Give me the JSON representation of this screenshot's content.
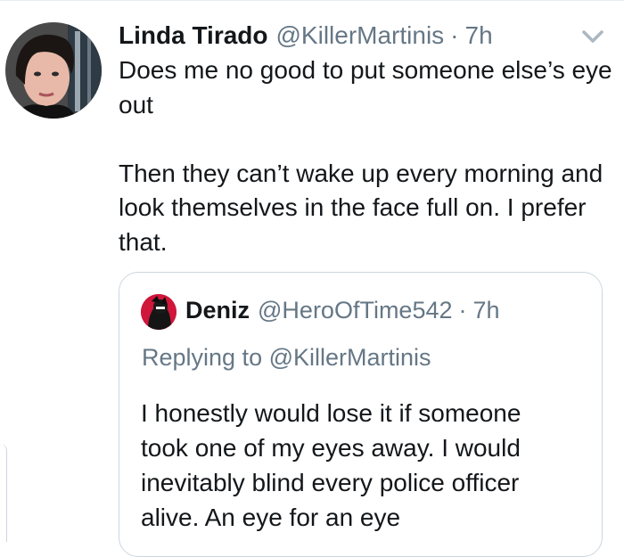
{
  "tweet": {
    "author_name": "Linda Tirado",
    "author_handle": "@KillerMartinis",
    "separator": "·",
    "time": "7h",
    "text": "Does me no good to put someone else’s eye out\n\nThen they can’t wake up every morning and look themselves in the face full on. I prefer that."
  },
  "quoted_tweet": {
    "author_name": "Deniz",
    "author_handle": "@HeroOfTime542",
    "separator": "·",
    "time": "7h",
    "replying_prefix": "Replying to",
    "replying_to": "@KillerMartinis",
    "text": "I honestly would lose it if someone took one of my eyes away. I would inevitably blind every police officer alive. An eye for an eye"
  },
  "icons": {
    "menu": "chevron-down-icon"
  },
  "colors": {
    "text": "#14171a",
    "secondary": "#657786",
    "border": "#ccd6dd",
    "quote_avatar_accent": "#e0245e"
  }
}
